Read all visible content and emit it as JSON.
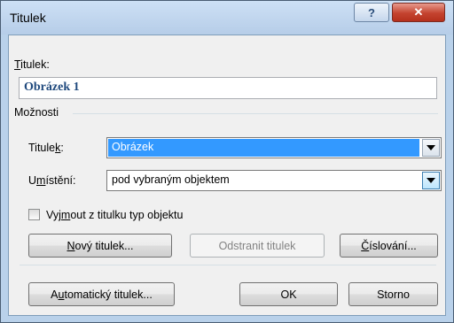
{
  "window": {
    "title": "Titulek"
  },
  "titlebar": {
    "help_glyph": "?",
    "close_glyph": "✕"
  },
  "caption": {
    "label_prefix": "",
    "label_u": "T",
    "label_rest": "itulek:",
    "value": "Obrázek 1"
  },
  "options": {
    "group_label": "Možnosti"
  },
  "label_combo": {
    "label_a": "Titule",
    "label_u": "k",
    "label_b": ":",
    "value": "Obrázek"
  },
  "position_combo": {
    "label_a": "U",
    "label_u": "m",
    "label_b": "ístění:",
    "value": "pod vybraným objektem"
  },
  "exclude": {
    "label_a": "Vyj",
    "label_u": "m",
    "label_b": "out z titulku typ objektu",
    "checked": false
  },
  "buttons": {
    "new_a": "",
    "new_u": "N",
    "new_b": "ový titulek...",
    "delete": "Odstranit titulek",
    "numbering_a": "",
    "numbering_u": "Č",
    "numbering_b": "íslování...",
    "auto_a": "A",
    "auto_u": "u",
    "auto_b": "tomatický titulek...",
    "ok": "OK",
    "cancel": "Storno"
  }
}
